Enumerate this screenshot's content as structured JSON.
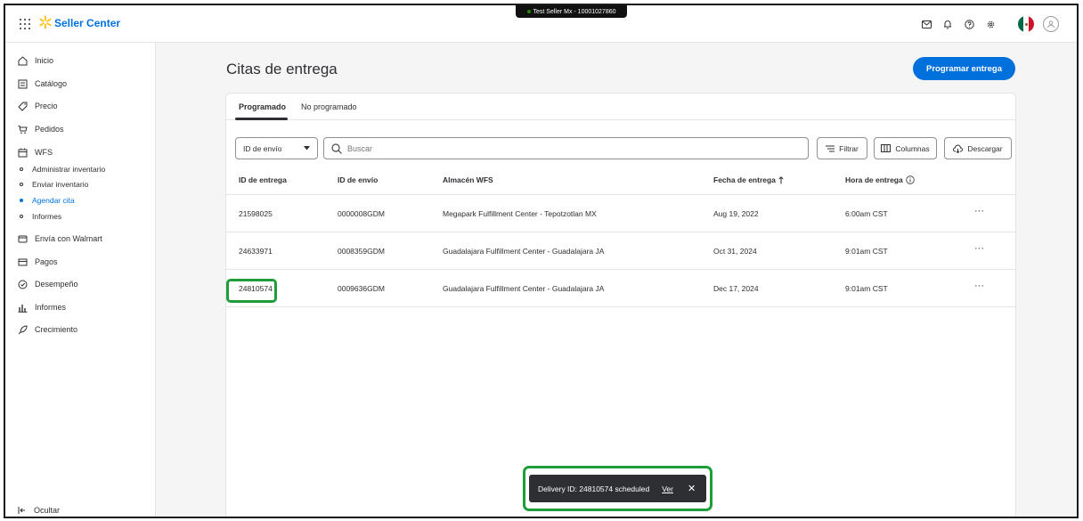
{
  "header": {
    "brand": "Seller Center",
    "seller_badge": "Test Seller Mx - 10001027860"
  },
  "sidebar": {
    "items": [
      {
        "label": "Inicio",
        "icon": "home-icon"
      },
      {
        "label": "Catálogo",
        "icon": "catalog-icon"
      },
      {
        "label": "Precio",
        "icon": "tag-icon"
      },
      {
        "label": "Pedidos",
        "icon": "cart-icon"
      },
      {
        "label": "WFS",
        "icon": "calendar-icon"
      }
    ],
    "wfs_sub": [
      {
        "label": "Administrar inventario"
      },
      {
        "label": "Enviar inventario"
      },
      {
        "label": "Agendar cita"
      },
      {
        "label": "Informes"
      }
    ],
    "items_after": [
      {
        "label": "Envía con Walmart",
        "icon": "truck-icon"
      },
      {
        "label": "Pagos",
        "icon": "payments-icon"
      },
      {
        "label": "Desempeño",
        "icon": "gauge-icon"
      },
      {
        "label": "Informes",
        "icon": "bar-chart-icon"
      },
      {
        "label": "Crecimiento",
        "icon": "rocket-icon"
      }
    ],
    "hide_label": "Ocultar"
  },
  "main": {
    "title": "Citas de entrega",
    "primary_button": "Programar entrega",
    "tabs": [
      "Programado",
      "No programado"
    ],
    "filter_select": "ID de envío",
    "search_placeholder": "Buscar",
    "buttons": {
      "filter": "Filtrar",
      "columns": "Columnas",
      "download": "Descargar"
    },
    "columns": [
      "ID de entrega",
      "ID de envío",
      "Almacén WFS",
      "Fecha de entrega",
      "Hora de entrega"
    ],
    "rows": [
      [
        "21598025",
        "0000008GDM",
        "Megapark Fulfillment Center - Tepotzotlan MX",
        "Aug 19, 2022",
        "6:00am CST"
      ],
      [
        "24633971",
        "0008359GDM",
        "Guadalajara Fulfillment Center - Guadalajara JA",
        "Oct 31, 2024",
        "9:01am CST"
      ],
      [
        "24810574",
        "0009636GDM",
        "Guadalajara Fulfillment Center - Guadalajara JA",
        "Dec 17, 2024",
        "9:01am CST"
      ]
    ],
    "row_menu": "···"
  },
  "toast": {
    "message": "Delivery ID: 24810574 scheduled",
    "link": "Ver",
    "close": "✕"
  },
  "colors": {
    "accent": "#0071dc",
    "spark": "#ffc220",
    "highlight": "#1f9d3a"
  }
}
